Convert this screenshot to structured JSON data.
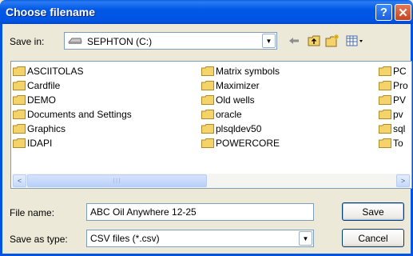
{
  "window": {
    "title": "Choose filename",
    "help_glyph": "?",
    "close_glyph": "✕"
  },
  "save_in": {
    "label": "Save in:",
    "value": "SEPHTON (C:)",
    "icons": [
      "back-arrow-icon",
      "up-folder-icon",
      "new-folder-icon",
      "view-menu-icon"
    ]
  },
  "files": [
    "ASCIITOLAS",
    "Cardfile",
    "DEMO",
    "Documents and Settings",
    "Graphics",
    "IDAPI",
    "Matrix symbols",
    "Maximizer",
    "Old wells",
    "oracle",
    "plsqldev50",
    "POWERCORE",
    "PC",
    "Pro",
    "PV",
    "pv",
    "sql",
    "To"
  ],
  "scrollbar": {
    "left_arrow": "<",
    "right_arrow": ">",
    "grip": "III"
  },
  "filename": {
    "label": "File name:",
    "value": "ABC Oil Anywhere 12-25"
  },
  "savetype": {
    "label": "Save as type:",
    "value": "CSV files (*.csv)"
  },
  "buttons": {
    "save": "Save",
    "cancel": "Cancel"
  },
  "colors": {
    "title_bar": "#0054E3",
    "folder": "#F5D36B",
    "dialog_bg": "#ECE9D8"
  }
}
